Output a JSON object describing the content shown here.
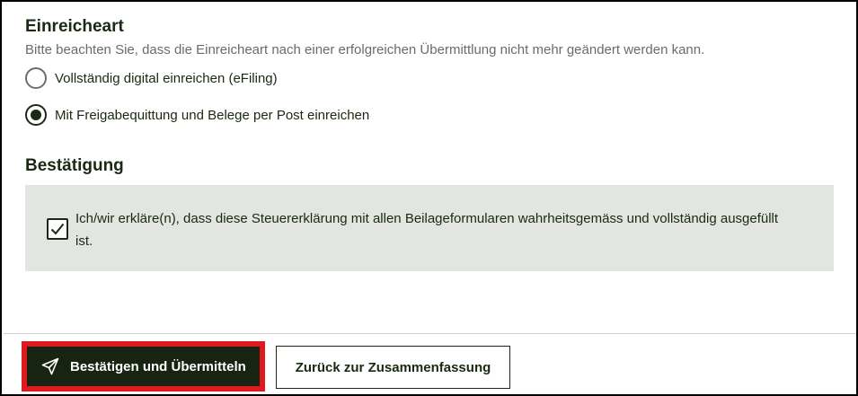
{
  "einreicheart": {
    "title": "Einreicheart",
    "hint": "Bitte beachten Sie, dass die Einreicheart nach einer erfolgreichen Übermittlung nicht mehr geändert werden kann.",
    "options": [
      {
        "label": "Vollständig digital einreichen (eFiling)",
        "selected": false
      },
      {
        "label": "Mit Freigabequittung und Belege per Post einreichen",
        "selected": true
      }
    ]
  },
  "bestaetigung": {
    "title": "Bestätigung",
    "checkbox_checked": true,
    "checkbox_text": "Ich/wir erkläre(n), dass diese Steuererklärung mit allen Beilageformularen wahrheitsgemäss und vollständig ausgefüllt ist."
  },
  "footer": {
    "submit_label": "Bestätigen und Übermitteln",
    "submit_icon": "send-icon",
    "back_label": "Zurück zur Zusammenfassung"
  },
  "colors": {
    "primary": "#172412",
    "highlight": "#e0191e",
    "panel": "#e3e5e1"
  }
}
